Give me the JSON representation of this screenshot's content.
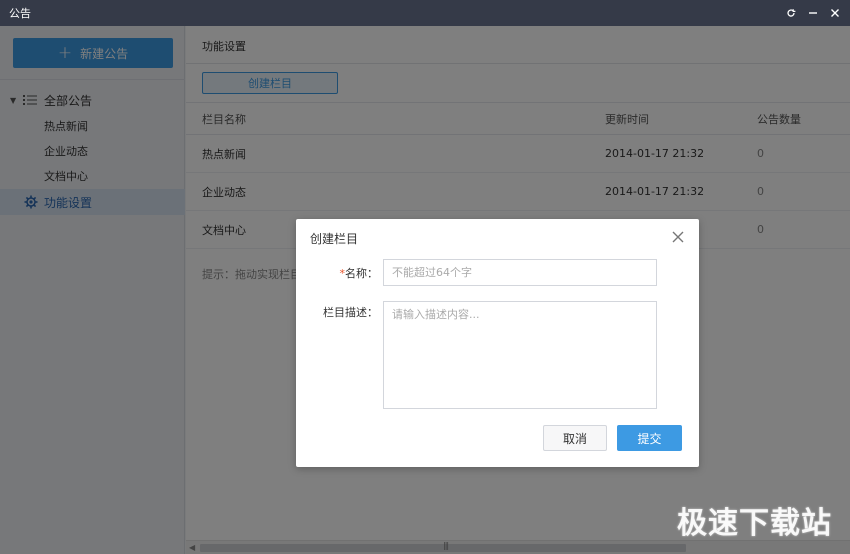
{
  "window": {
    "title": "公告",
    "controls": [
      "refresh-icon",
      "minimize-icon",
      "close-icon"
    ]
  },
  "sidebar": {
    "new_button_label": "新建公告",
    "root_label": "全部公告",
    "children": [
      "热点新闻",
      "企业动态",
      "文档中心"
    ],
    "active_item_label": "功能设置"
  },
  "main": {
    "title": "功能设置",
    "create_button_label": "创建栏目",
    "table": {
      "headers": [
        "栏目名称",
        "更新时间",
        "公告数量"
      ],
      "rows": [
        {
          "name": "热点新闻",
          "time": "2014-01-17 21:32",
          "count": "0"
        },
        {
          "name": "企业动态",
          "time": "2014-01-17 21:32",
          "count": "0"
        },
        {
          "name": "文档中心",
          "time": "",
          "count": "0"
        }
      ]
    },
    "hint": "提示：拖动实现栏目排"
  },
  "dialog": {
    "title": "创建栏目",
    "name_required_mark": "*",
    "name_label": "名称：",
    "name_placeholder": "不能超过64个字",
    "desc_label": "栏目描述：",
    "desc_placeholder": "请输入描述内容...",
    "cancel_label": "取消",
    "submit_label": "提交"
  },
  "watermark": "极速下载站",
  "colors": {
    "titlebar": "#353a48",
    "accent": "#3d9ae3",
    "sidebar_bg": "#eef0f4",
    "active_bg": "#d6e3f1",
    "required": "#e8542b"
  }
}
